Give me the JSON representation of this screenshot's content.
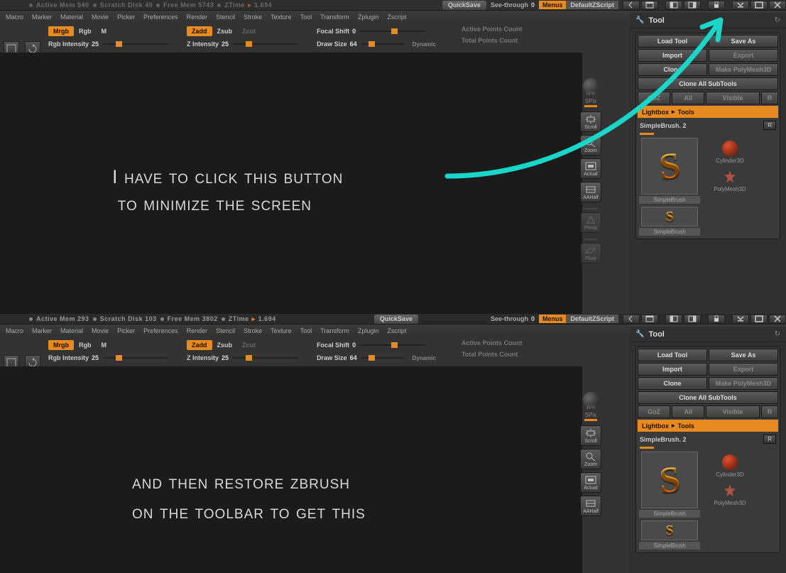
{
  "status_top": {
    "mem": "540",
    "scratch": "40",
    "free": "5743",
    "ztime": "1.694"
  },
  "status_bot": {
    "mem": "293",
    "scratch": "103",
    "free": "3802",
    "ztime": "1.694"
  },
  "status_labels": {
    "mem": "Active Mem",
    "scratch": "Scratch Disk",
    "free": "Free Mem",
    "ztime": "ZTime"
  },
  "toprow": {
    "quicksave": "QuickSave",
    "seethrough": "See-through",
    "seeval": "0",
    "menus": "Menus",
    "defscript": "DefaultZScript"
  },
  "menus": [
    "Macro",
    "Marker",
    "Material",
    "Movie",
    "Picker",
    "Preferences",
    "Render",
    "Stencil",
    "Stroke",
    "Texture",
    "Tool",
    "Transform",
    "Zplugin",
    "Zscript"
  ],
  "side": {
    "scale": "Scale",
    "rotate": "Rotate"
  },
  "brush": {
    "mrgb": "Mrgb",
    "rgb": "Rgb",
    "m": "M",
    "zadd": "Zadd",
    "zsub": "Zsub",
    "zcut": "Zcut",
    "rgb_int_label": "Rgb Intensity",
    "rgb_int_val": "25",
    "z_int_label": "Z Intensity",
    "z_int_val": "25",
    "focal_label": "Focal Shift",
    "focal_val": "0",
    "draw_label": "Draw Size",
    "draw_val": "64",
    "dynamic": "Dynamic",
    "apc": "Active Points Count",
    "tpc": "Total Points Count"
  },
  "rnav": {
    "bpr": "BPR",
    "spix": "SPix",
    "scroll": "Scroll",
    "zoom": "Zoom",
    "actual": "Actual",
    "aahalf": "AAHalf",
    "persp": "Persp",
    "floor": "Floor"
  },
  "tool": {
    "title": "Tool",
    "load": "Load Tool",
    "saveas": "Save As",
    "import": "Import",
    "export": "Export",
    "clone": "Clone",
    "makepoly": "Make PolyMesh3D",
    "cloneall": "Clone All SubTools",
    "goz": "GoZ",
    "all": "All",
    "visible": "Visible",
    "r": "R",
    "lb": "Lightbox",
    "lb2": "Tools",
    "brushname": "SimpleBrush. 2",
    "th_simple": "SimpleBrush",
    "th_cyl": "Cylinder3D",
    "th_pm": "PolyMesh3D"
  },
  "anno": {
    "top1": "I have to click this button",
    "top2": "to minimize the screen",
    "bot1": "and then restore zbrush",
    "bot2": "on the toolbar to get this"
  }
}
